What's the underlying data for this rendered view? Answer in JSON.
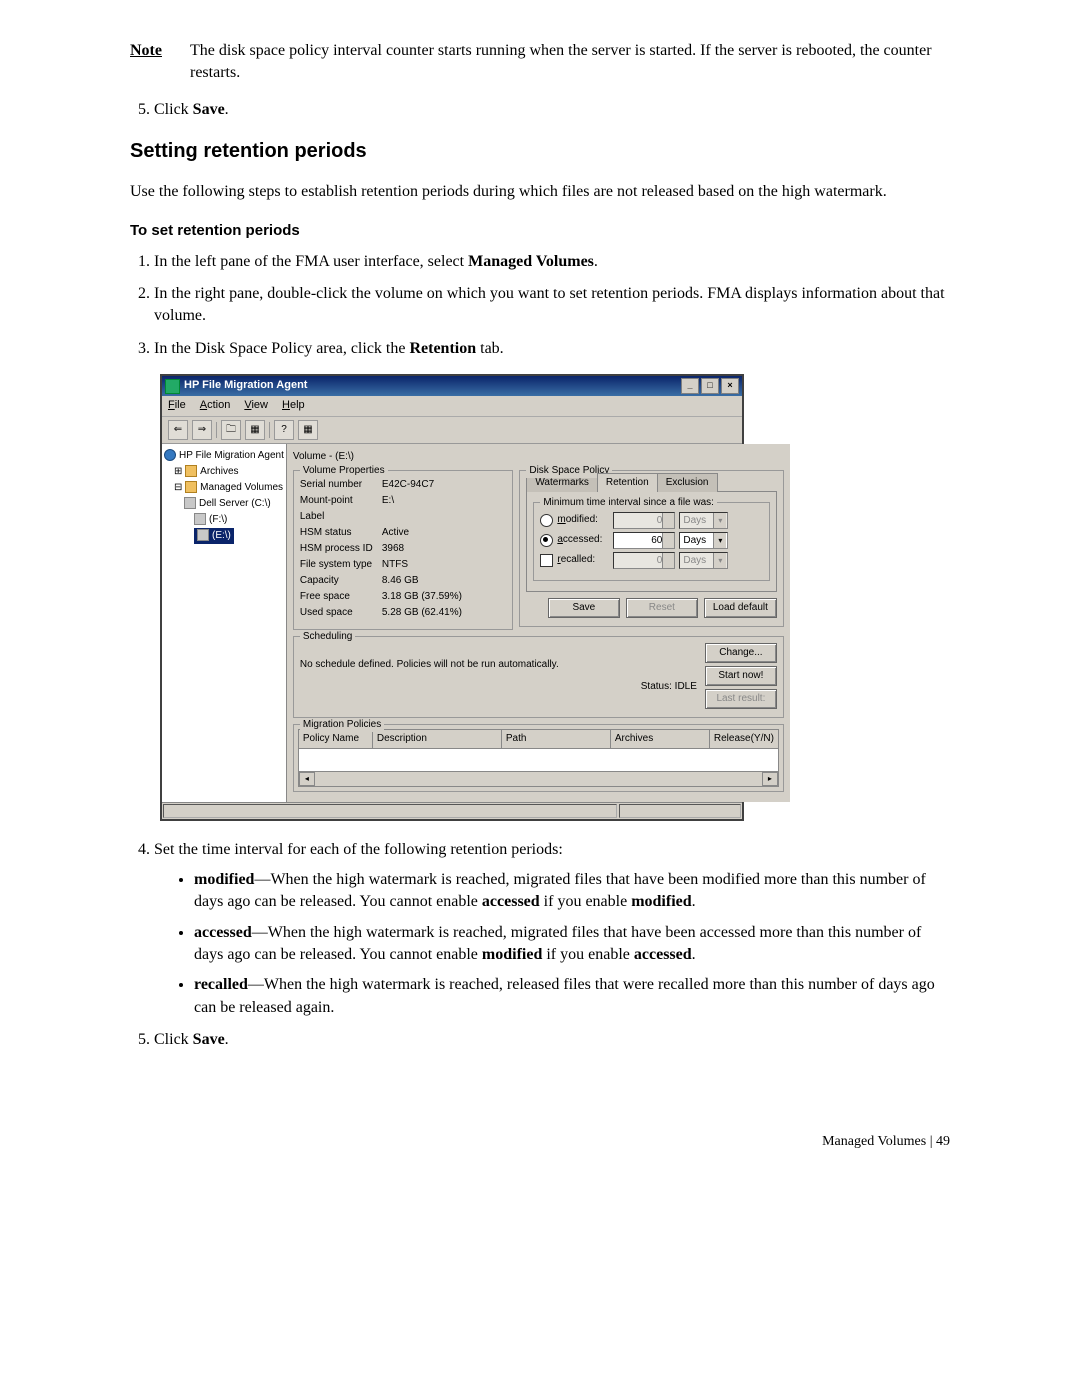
{
  "note": {
    "label": "Note",
    "text": "The disk space policy interval counter starts running when the server is started. If the server is rebooted, the counter restarts."
  },
  "step5a": "Click ",
  "step5a_bold": "Save",
  "step5a_end": ".",
  "heading1": "Setting retention periods",
  "intro": "Use the following steps to establish retention periods during which files are not released based on the high watermark.",
  "subhead": "To set retention periods",
  "s1_a": "In the left pane of the FMA user interface, select ",
  "s1_b": "Managed Volumes",
  "s1_c": ".",
  "s2": "In the right pane, double-click the volume on which you want to set retention periods. FMA displays information about that volume.",
  "s3_a": "In the Disk Space Policy area, click the ",
  "s3_b": "Retention",
  "s3_c": " tab.",
  "window": {
    "title": "HP File Migration Agent",
    "menu": {
      "file": "File",
      "action": "Action",
      "view": "View",
      "help": "Help"
    },
    "tree": {
      "root": "HP File Migration Agent",
      "archives": "Archives",
      "managed": "Managed Volumes",
      "dell": "Dell Server (C:\\)",
      "f": "(F:\\)",
      "e": "(E:\\)"
    },
    "detail_header": "Volume - (E:\\)",
    "vp": {
      "title": "Volume Properties",
      "rows": [
        {
          "label": "Serial number",
          "value": "E42C-94C7"
        },
        {
          "label": "Mount-point",
          "value": "E:\\"
        },
        {
          "label": "Label",
          "value": ""
        },
        {
          "label": "HSM status",
          "value": "Active"
        },
        {
          "label": "HSM process ID",
          "value": "3968"
        },
        {
          "label": "File system type",
          "value": "NTFS"
        },
        {
          "label": "Capacity",
          "value": "8.46 GB"
        },
        {
          "label": "Free space",
          "value": "3.18 GB (37.59%)"
        },
        {
          "label": "Used space",
          "value": "5.28 GB (62.41%)"
        }
      ]
    },
    "dsp": {
      "title": "Disk Space Policy",
      "tabs": {
        "watermarks": "Watermarks",
        "retention": "Retention",
        "exclusion": "Exclusion"
      },
      "inner_title": "Minimum time interval since a file was:",
      "modified_label": "modified:",
      "modified_value": "0",
      "accessed_label": "accessed:",
      "accessed_value": "60",
      "recalled_label": "recalled:",
      "recalled_value": "0",
      "days": "Days",
      "save": "Save",
      "reset": "Reset",
      "load_default": "Load default"
    },
    "sched": {
      "title": "Scheduling",
      "text": "No schedule defined. Policies will not be run automatically.",
      "status_label": "Status: IDLE",
      "change": "Change...",
      "start": "Start now!",
      "last": "Last result:"
    },
    "pol": {
      "title": "Migration Policies",
      "h1": "Policy Name",
      "h2": "Description",
      "h3": "Path",
      "h4": "Archives",
      "h5": "Release(Y/N)"
    }
  },
  "s4": "Set the time interval for each of the following retention periods:",
  "b1_term": "modified",
  "b1_text": "—When the high watermark is reached, migrated files that have been modified more than this number of days ago can be released. You cannot enable ",
  "b1_bold2": "accessed",
  "b1_text2": " if you enable ",
  "b1_bold3": "modified",
  "b1_end": ".",
  "b2_term": "accessed",
  "b2_text": "—When the high watermark is reached, migrated files that have been accessed more than this number of days ago can be released. You cannot enable ",
  "b2_bold2": "modified",
  "b2_text2": " if you enable ",
  "b2_bold3": "accessed",
  "b2_end": ".",
  "b3_term": "recalled",
  "b3_text": "—When the high watermark is reached, released files that were recalled more than this number of days ago can be released again.",
  "s5_a": "Click ",
  "s5_b": "Save",
  "s5_c": ".",
  "footer": "Managed Volumes | 49"
}
